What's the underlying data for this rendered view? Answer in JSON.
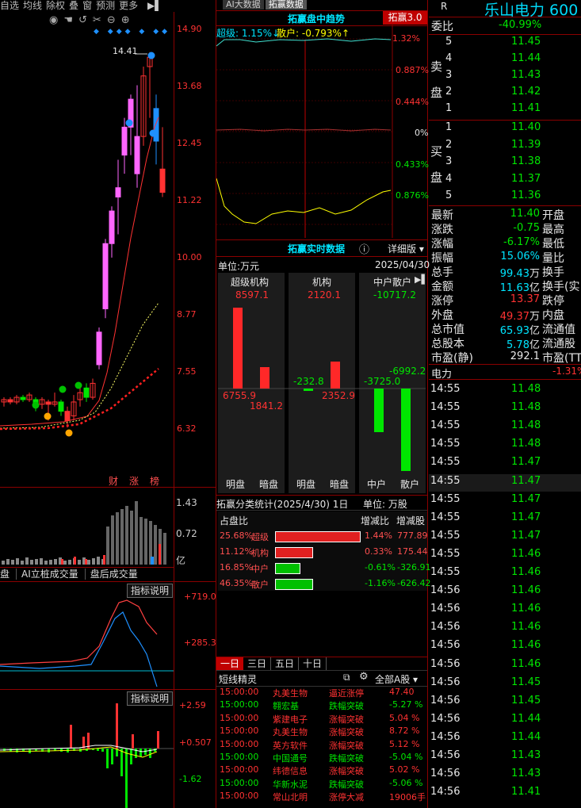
{
  "toolbar": {
    "items": [
      "自选",
      "均线",
      "除权",
      "叠",
      "窗",
      "预测",
      "更多"
    ]
  },
  "kline": {
    "price_labels": [
      "14.90",
      "13.68",
      "12.45",
      "11.22",
      "10.00",
      "8.77",
      "7.55",
      "6.32"
    ],
    "high_label": "14.41",
    "bottom_tags": [
      "财",
      "涨",
      "榜"
    ],
    "vol_labels": [
      "1.43",
      "0.72",
      "亿"
    ],
    "vol_tabs": [
      "盘",
      "AI立桩成交量",
      "盘后成交量"
    ],
    "ind1_btn": "指标说明",
    "ind1_labels": [
      "+719.0",
      "+285.3"
    ],
    "ind2_btn": "指标说明",
    "ind2_labels": [
      "+2.59",
      "+0.507",
      "-1.62"
    ],
    "colors": {
      "up": "#ff3232",
      "down": "#00e600",
      "ma1": "#ff3232",
      "ma2": "#ffff66"
    }
  },
  "mid": {
    "tabs": [
      "AI大数据",
      "拓赢数据"
    ],
    "trend_title": "拓赢盘中趋势",
    "trend_badge": "拓赢3.0",
    "super_label": "超级: 1.15%↓",
    "retail_label": "散户: -0.793%↑",
    "trend_axis": [
      "1.32%",
      "0.887%",
      "0.444%",
      "0%",
      "0.433%",
      "0.876%"
    ],
    "rt_title": "拓赢实时数据",
    "rt_detail": "详细版",
    "unit": "单位:万元",
    "date": "2025/04/30",
    "cols": [
      {
        "head": "超级机构",
        "top": "8597.1",
        "left": "6755.9",
        "right": "1841.2",
        "bars": [
          {
            "c": "r",
            "v": 8597.1
          },
          {
            "c": "r",
            "v": 2120
          }
        ],
        "lbl": [
          "明盘",
          "暗盘"
        ]
      },
      {
        "head": "机构",
        "top": "2120.1",
        "left": "-232.8",
        "right": "2352.9",
        "lbl": [
          "明盘",
          "暗盘"
        ]
      },
      {
        "head": "中户散户",
        "top": "-10717.2",
        "left": "-3725.0",
        "right": "-6992.2",
        "lbl": [
          "中户",
          "散户"
        ]
      }
    ],
    "stat_title": "拓赢分类统计(2025/4/30) 1日",
    "stat_unit": "单位: 万股",
    "stat_head": [
      "占盘比",
      "增减比",
      "增减股"
    ],
    "stat_rows": [
      {
        "pct": "25.68%",
        "name": "超级",
        "ratio": "1.44%",
        "shares": "777.89",
        "color": "#e02020",
        "fill": 1.0
      },
      {
        "pct": "11.12%",
        "name": "机构",
        "ratio": "0.33%",
        "shares": "175.44",
        "color": "#e02020",
        "fill": 0.43
      },
      {
        "pct": "16.85%",
        "name": "中户",
        "ratio": "-0.61%",
        "shares": "-326.91",
        "color": "#00c000",
        "fill": 0.65
      },
      {
        "pct": "46.35%",
        "name": "散户",
        "ratio": "-1.16%",
        "shares": "-626.42",
        "color": "#00c000",
        "fill": 1.0
      }
    ],
    "day_tabs": [
      "一日",
      "三日",
      "五日",
      "十日"
    ],
    "news_title": "短线精灵",
    "news_filter": "全部A股",
    "news": [
      {
        "t": "15:00:00",
        "n": "丸美生物",
        "e": "逼近涨停",
        "v": "47.40",
        "c": "red"
      },
      {
        "t": "15:00:00",
        "n": "翱宏基",
        "e": "跌幅突破",
        "v": "-5.27 %",
        "c": "green"
      },
      {
        "t": "15:00:00",
        "n": "紫建电子",
        "e": "涨幅突破",
        "v": "5.04 %",
        "c": "red"
      },
      {
        "t": "15:00:00",
        "n": "丸美生物",
        "e": "涨幅突破",
        "v": "8.72 %",
        "c": "red"
      },
      {
        "t": "15:00:00",
        "n": "英方软件",
        "e": "涨幅突破",
        "v": "5.12 %",
        "c": "red"
      },
      {
        "t": "15:00:00",
        "n": "中国通号",
        "e": "跌幅突破",
        "v": "-5.04 %",
        "c": "green"
      },
      {
        "t": "15:00:00",
        "n": "纬德信息",
        "e": "涨幅突破",
        "v": "5.02 %",
        "c": "red"
      },
      {
        "t": "15:00:00",
        "n": "华新水泥",
        "e": "跌幅突破",
        "v": "-5.06 %",
        "c": "green"
      },
      {
        "t": "15:00:00",
        "n": "常山北明",
        "e": "涨停大减",
        "v": "19006手",
        "c": "red"
      }
    ]
  },
  "right": {
    "r_label": "R",
    "name": "乐山电力 600",
    "wb_label": "委比",
    "wb": "-40.99%",
    "sell": [
      {
        "l": "5",
        "p": "11.45"
      },
      {
        "l": "4",
        "p": "11.44"
      },
      {
        "l": "3",
        "p": "11.43"
      },
      {
        "l": "2",
        "p": "11.42"
      },
      {
        "l": "1",
        "p": "11.41"
      }
    ],
    "sell_side": [
      "卖",
      "盘"
    ],
    "buy": [
      {
        "l": "1",
        "p": "11.40"
      },
      {
        "l": "2",
        "p": "11.39"
      },
      {
        "l": "3",
        "p": "11.38"
      },
      {
        "l": "4",
        "p": "11.37"
      },
      {
        "l": "5",
        "p": "11.36"
      }
    ],
    "buy_side": [
      "买",
      "盘"
    ],
    "stats": [
      {
        "k": "最新",
        "v": "11.40",
        "c": "green",
        "k2": "开盘"
      },
      {
        "k": "涨跌",
        "v": "-0.75",
        "c": "green",
        "k2": "最高"
      },
      {
        "k": "涨幅",
        "v": "-6.17%",
        "c": "green",
        "k2": "最低"
      },
      {
        "k": "振幅",
        "v": "15.06%",
        "c": "cyan",
        "k2": "量比"
      },
      {
        "k": "总手",
        "v": "99.43",
        "u": "万",
        "c": "cyan",
        "k2": "换手"
      },
      {
        "k": "金额",
        "v": "11.63",
        "u": "亿",
        "c": "cyan",
        "k2": "换手(实"
      },
      {
        "k": "涨停",
        "v": "13.37",
        "c": "red",
        "k2": "跌停"
      },
      {
        "k": "外盘",
        "v": "49.37",
        "u": "万",
        "c": "red",
        "k2": "内盘"
      },
      {
        "k": "总市值",
        "v": "65.93",
        "u": "亿",
        "c": "cyan",
        "k2": "流通值"
      },
      {
        "k": "总股本",
        "v": "5.78",
        "u": "亿",
        "c": "cyan",
        "k2": "流通股"
      },
      {
        "k": "市盈(静)",
        "v": "292.1",
        "c": "white",
        "k2": "市盈(TT"
      }
    ],
    "sector": "电力",
    "sector_chg": "-1.31%",
    "ticks": [
      {
        "t": "14:55",
        "p": "11.48"
      },
      {
        "t": "14:55",
        "p": "11.48"
      },
      {
        "t": "14:55",
        "p": "11.48"
      },
      {
        "t": "14:55",
        "p": "11.48"
      },
      {
        "t": "14:55",
        "p": "11.47"
      },
      {
        "t": "14:55",
        "p": "11.47"
      },
      {
        "t": "14:55",
        "p": "11.47"
      },
      {
        "t": "14:55",
        "p": "11.47"
      },
      {
        "t": "14:55",
        "p": "11.47"
      },
      {
        "t": "14:55",
        "p": "11.46"
      },
      {
        "t": "14:55",
        "p": "11.46"
      },
      {
        "t": "14:56",
        "p": "11.46"
      },
      {
        "t": "14:56",
        "p": "11.46"
      },
      {
        "t": "14:56",
        "p": "11.46"
      },
      {
        "t": "14:56",
        "p": "11.46"
      },
      {
        "t": "14:56",
        "p": "11.46"
      },
      {
        "t": "14:56",
        "p": "11.45"
      },
      {
        "t": "14:56",
        "p": "11.45"
      },
      {
        "t": "14:56",
        "p": "11.44"
      },
      {
        "t": "14:56",
        "p": "11.44"
      },
      {
        "t": "14:56",
        "p": "11.43"
      },
      {
        "t": "14:56",
        "p": "11.43"
      },
      {
        "t": "14:56",
        "p": "11.41"
      }
    ]
  }
}
